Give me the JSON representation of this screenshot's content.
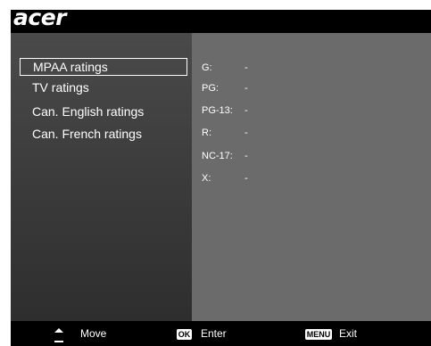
{
  "brand": {
    "logo_text": "acer"
  },
  "menu": {
    "items": [
      {
        "label": "MPAA ratings",
        "selected": true
      },
      {
        "label": "TV ratings",
        "selected": false
      },
      {
        "label": "Can. English ratings",
        "selected": false
      },
      {
        "label": "Can. French ratings",
        "selected": false
      }
    ]
  },
  "ratings": [
    {
      "label": "G:",
      "value": "-"
    },
    {
      "label": "PG:",
      "value": "-"
    },
    {
      "label": "PG-13:",
      "value": "-"
    },
    {
      "label": "R:",
      "value": "-"
    },
    {
      "label": "NC-17:",
      "value": "-"
    },
    {
      "label": "X:",
      "value": "-"
    }
  ],
  "footer": {
    "move_label": "Move",
    "ok_key": "OK",
    "enter_label": "Enter",
    "menu_key": "MENU",
    "exit_label": "Exit"
  },
  "colors": {
    "left_panel": "#3d3d3d",
    "right_panel": "#6b6b6b",
    "text": "#ffffff",
    "background": "#000000"
  }
}
